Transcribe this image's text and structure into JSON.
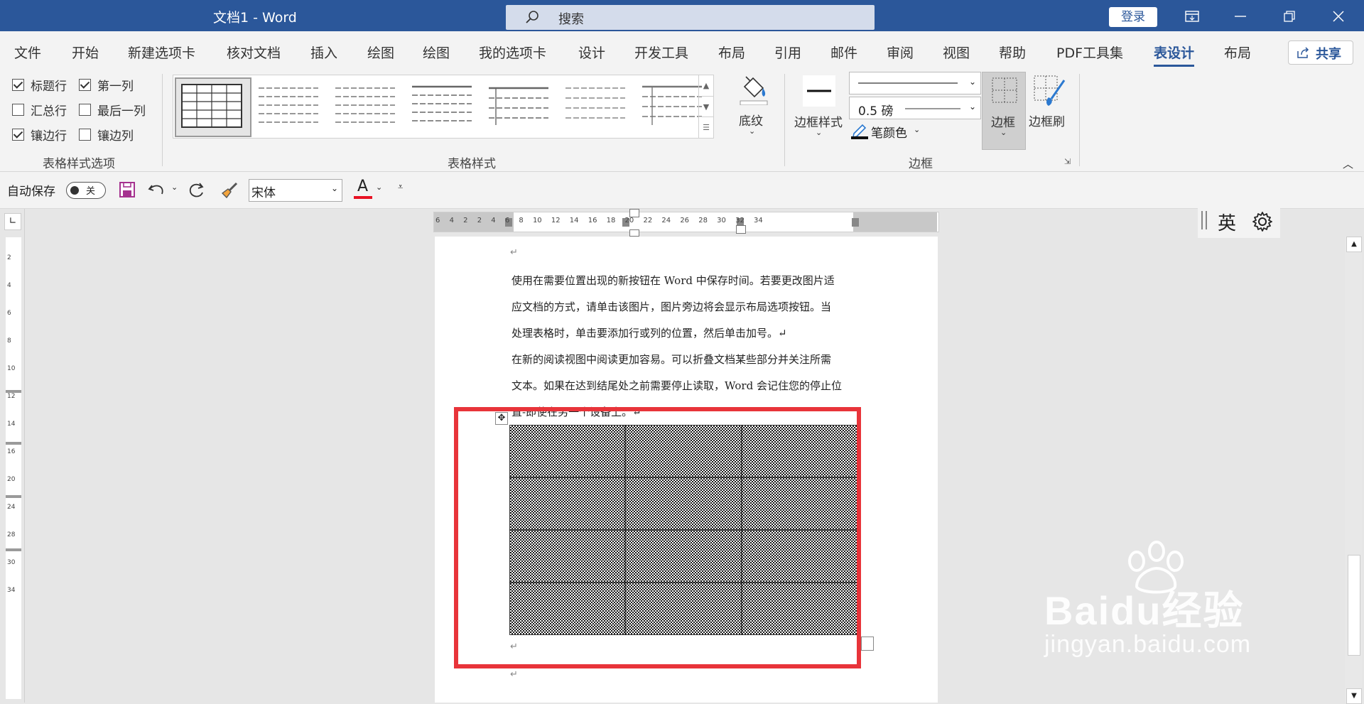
{
  "window": {
    "title": "文档1 - Word",
    "search_label": "搜索",
    "login_label": "登录"
  },
  "tabs": [
    "文件",
    "开始",
    "新建选项卡",
    "核对文档",
    "插入",
    "绘图",
    "绘图",
    "我的选项卡",
    "设计",
    "开发工具",
    "布局",
    "引用",
    "邮件",
    "审阅",
    "视图",
    "帮助",
    "PDF工具集",
    "表设计",
    "布局"
  ],
  "active_tab": "表设计",
  "share_label": "共享",
  "ribbon": {
    "style_options": {
      "header_row": {
        "label": "标题行",
        "checked": true
      },
      "total_row": {
        "label": "汇总行",
        "checked": false
      },
      "banded_rows": {
        "label": "镶边行",
        "checked": true
      },
      "first_column": {
        "label": "第一列",
        "checked": true
      },
      "last_column": {
        "label": "最后一列",
        "checked": false
      },
      "banded_columns": {
        "label": "镶边列",
        "checked": false
      },
      "group_label": "表格样式选项"
    },
    "table_styles": {
      "group_label": "表格样式",
      "shading_label": "底纹"
    },
    "borders": {
      "border_styles_label": "边框样式",
      "line_weight": "0.5 磅",
      "pen_color_label": "笔颜色",
      "borders_label": "边框",
      "border_painter_label": "边框刷",
      "group_label": "边框"
    }
  },
  "qat": {
    "autosave_label": "自动保存",
    "autosave_state": "关",
    "font_name": "宋体",
    "font_color": "#e81123"
  },
  "ime": {
    "mode": "英"
  },
  "ruler_h": [
    "6",
    "4",
    "2",
    "",
    "2",
    "4",
    "6",
    "8",
    "10",
    "12",
    "14",
    "16",
    "18",
    "20",
    "22",
    "24",
    "26",
    "28",
    "30",
    "32",
    "34"
  ],
  "ruler_v": [
    "2",
    "4",
    "6",
    "8",
    "10",
    "12",
    "14",
    "16",
    "20",
    "24",
    "28",
    "30",
    "34"
  ],
  "document": {
    "lines": [
      "使用在需要位置出现的新按钮在 Word 中保存时间。若要更改图片适",
      "应文档的方式，请单击该图片，图片旁边将会显示布局选项按钮。当",
      "处理表格时，单击要添加行或列的位置，然后单击加号。↵",
      "在新的阅读视图中阅读更加容易。可以折叠文档某些部分并关注所需",
      "文本。如果在达到结尾处之前需要停止读取，Word 会记住您的停止位",
      "置-即使在另一个设备上。↵"
    ],
    "paragraph_mark": "↵",
    "table": {
      "rows": 4,
      "columns": 3
    }
  },
  "annotation": {
    "color": "#e8343a"
  },
  "watermark": {
    "brand": "Baidu经验",
    "url": "jingyan.baidu.com"
  }
}
